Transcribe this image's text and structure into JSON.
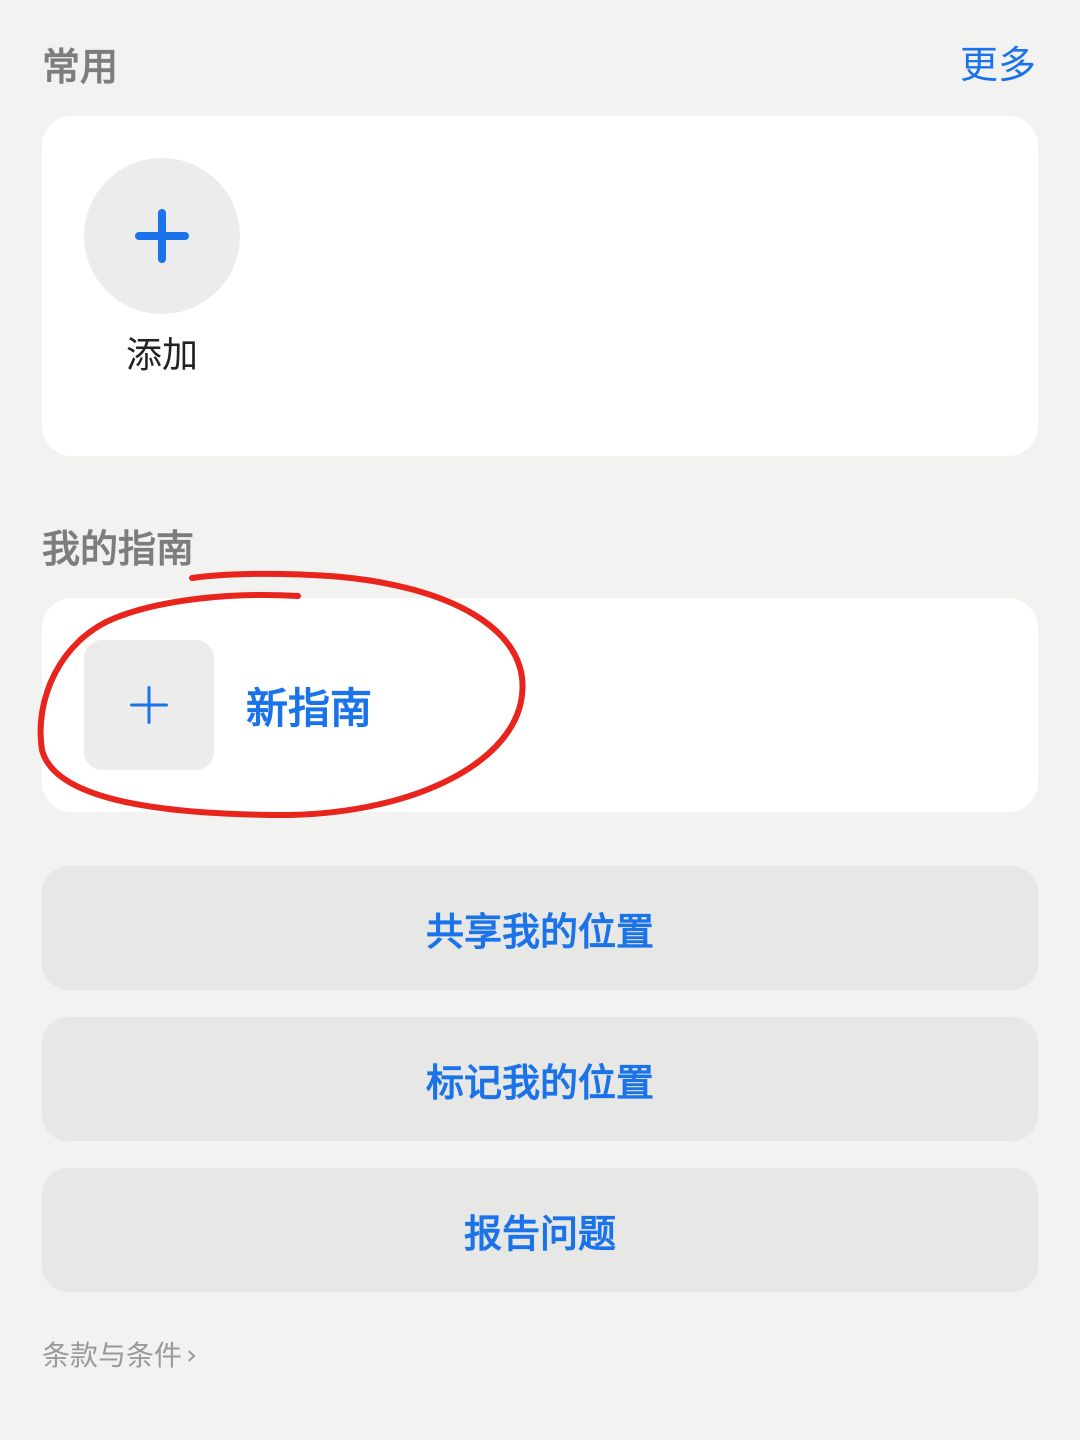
{
  "favorites": {
    "header": "常用",
    "more_label": "更多",
    "add_label": "添加"
  },
  "guides": {
    "header": "我的指南",
    "new_guide_label": "新指南"
  },
  "actions": {
    "share_location": "共享我的位置",
    "mark_location": "标记我的位置",
    "report_issue": "报告问题"
  },
  "footer": {
    "terms_label": "条款与条件",
    "terms_chevron": "›"
  },
  "colors": {
    "accent": "#1a73e8",
    "background": "#f2f2f0",
    "card": "#ffffff",
    "button": "#e7e7e5",
    "header_text": "#7d7d7d",
    "annotation": "#e8241c"
  },
  "icons": {
    "add_favorite": "plus-icon",
    "new_guide": "plus-icon",
    "terms": "chevron-right-icon"
  }
}
